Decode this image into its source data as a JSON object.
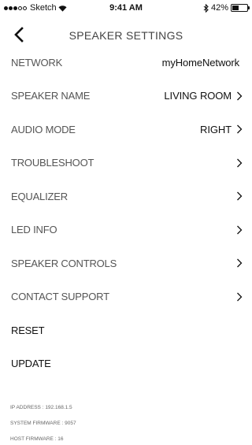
{
  "status_bar": {
    "carrier": "Sketch",
    "time": "9:41 AM",
    "battery": "42%",
    "battery_level": 0.42
  },
  "nav": {
    "title": "SPEAKER SETTINGS"
  },
  "settings": {
    "network_label": "NETWORK",
    "network_value": "myHomeNetwork",
    "speaker_name_label": "SPEAKER NAME",
    "speaker_name_value": "LIVING ROOM",
    "audio_mode_label": "AUDIO MODE",
    "audio_mode_value": "RIGHT",
    "troubleshoot_label": "TROUBLESHOOT",
    "equalizer_label": "EQUALIZER",
    "led_info_label": "LED INFO",
    "speaker_controls_label": "SPEAKER CONTROLS",
    "contact_support_label": "CONTACT SUPPORT",
    "reset_label": "RESET",
    "update_label": "UPDATE"
  },
  "info": {
    "ip_address": "IP ADDRESS : 192.168.1.5",
    "system_firmware": "SYSTEM FIRMWARE : 9057",
    "host_firmware": "HOST FIRMWARE : 16"
  }
}
